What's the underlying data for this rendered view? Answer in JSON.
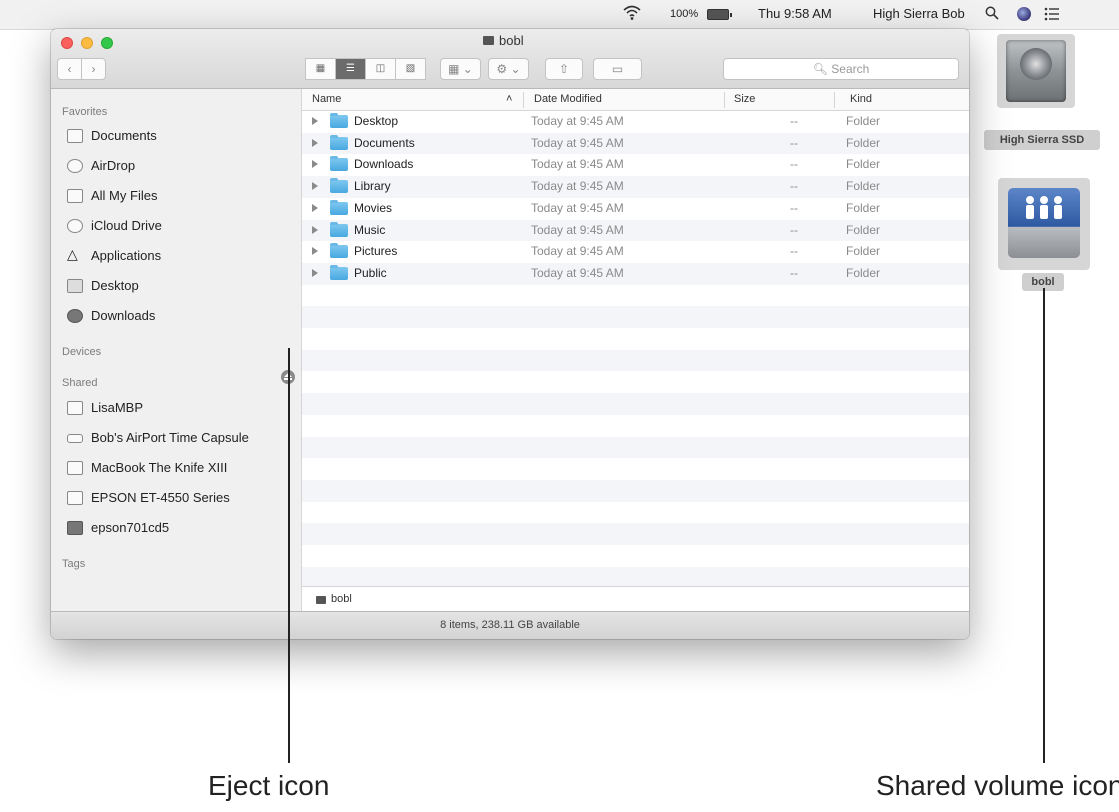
{
  "menubar": {
    "battery_pct": "100%",
    "clock": "Thu 9:58 AM",
    "user": "High Sierra Bob"
  },
  "desktop": {
    "hd_label": "High Sierra SSD",
    "share_label": "bobl"
  },
  "window": {
    "title": "bobl",
    "search_placeholder": "Search",
    "view_buttons": [
      "icon-view",
      "list-view",
      "column-view",
      "cover-flow-view"
    ],
    "selected_view": "list-view"
  },
  "sidebar": {
    "favorites_heading": "Favorites",
    "favorites": [
      {
        "label": "Documents",
        "icon": "documents-icon"
      },
      {
        "label": "AirDrop",
        "icon": "airdrop-icon"
      },
      {
        "label": "All My Files",
        "icon": "all-my-files-icon"
      },
      {
        "label": "iCloud Drive",
        "icon": "icloud-icon"
      },
      {
        "label": "Applications",
        "icon": "applications-icon"
      },
      {
        "label": "Desktop",
        "icon": "desktop-icon"
      },
      {
        "label": "Downloads",
        "icon": "downloads-icon"
      }
    ],
    "devices_heading": "Devices",
    "shared_heading": "Shared",
    "shared": [
      {
        "label": "LisaMBP",
        "icon": "laptop-icon"
      },
      {
        "label": "Bob's AirPort Time Capsule",
        "icon": "time-capsule-icon"
      },
      {
        "label": "MacBook The Knife XIII",
        "icon": "laptop-icon"
      },
      {
        "label": "EPSON ET-4550 Series",
        "icon": "monitor-icon"
      },
      {
        "label": "epson701cd5",
        "icon": "printer-icon"
      }
    ],
    "tags_heading": "Tags"
  },
  "list": {
    "columns": {
      "name": "Name",
      "date": "Date Modified",
      "size": "Size",
      "kind": "Kind"
    },
    "rows": [
      {
        "name": "Desktop",
        "date": "Today at 9:45 AM",
        "size": "--",
        "kind": "Folder"
      },
      {
        "name": "Documents",
        "date": "Today at 9:45 AM",
        "size": "--",
        "kind": "Folder"
      },
      {
        "name": "Downloads",
        "date": "Today at 9:45 AM",
        "size": "--",
        "kind": "Folder"
      },
      {
        "name": "Library",
        "date": "Today at 9:45 AM",
        "size": "--",
        "kind": "Folder"
      },
      {
        "name": "Movies",
        "date": "Today at 9:45 AM",
        "size": "--",
        "kind": "Folder"
      },
      {
        "name": "Music",
        "date": "Today at 9:45 AM",
        "size": "--",
        "kind": "Folder"
      },
      {
        "name": "Pictures",
        "date": "Today at 9:45 AM",
        "size": "--",
        "kind": "Folder"
      },
      {
        "name": "Public",
        "date": "Today at 9:45 AM",
        "size": "--",
        "kind": "Folder"
      }
    ]
  },
  "pathbar": {
    "label": "bobl"
  },
  "status": {
    "text": "8 items, 238.11 GB available"
  },
  "callouts": {
    "eject": "Eject icon",
    "shared_volume": "Shared volume icon"
  }
}
